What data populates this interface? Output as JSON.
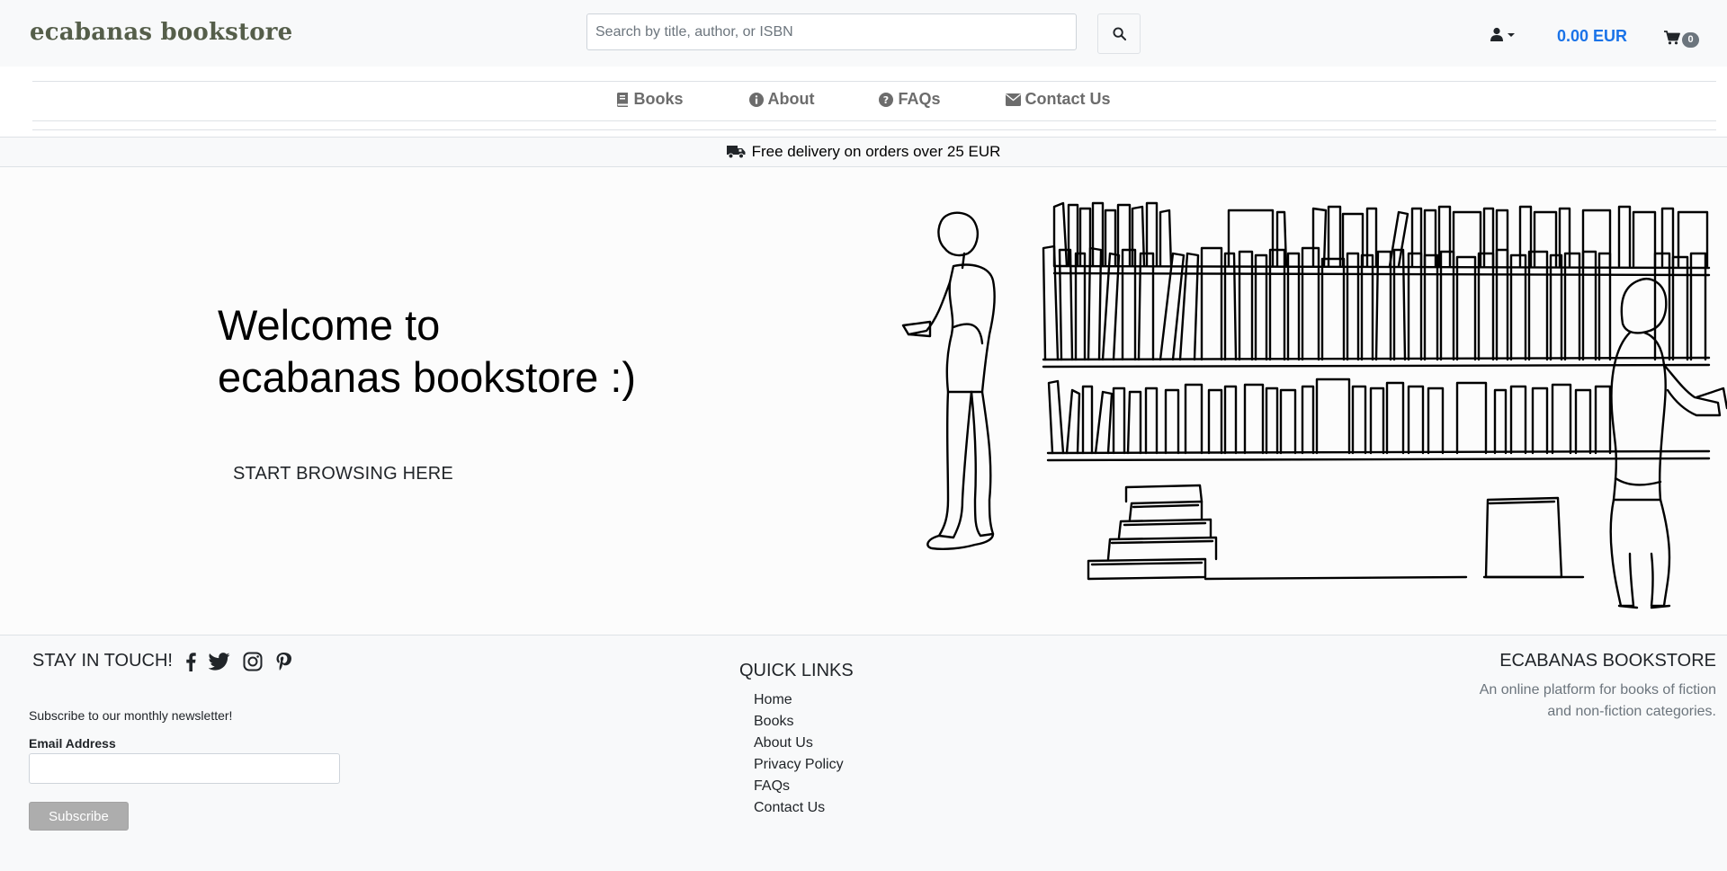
{
  "header": {
    "logo": "ecabanas bookstore",
    "search_placeholder": "Search by title, author, or ISBN",
    "balance": "0.00 EUR",
    "cart_count": "0"
  },
  "nav": {
    "items": [
      {
        "label": "Books",
        "icon": "book-icon"
      },
      {
        "label": "About",
        "icon": "info-icon"
      },
      {
        "label": "FAQs",
        "icon": "question-icon"
      },
      {
        "label": "Contact Us",
        "icon": "envelope-icon"
      }
    ]
  },
  "promo": {
    "text": "Free delivery on orders over 25 EUR"
  },
  "hero": {
    "title_line1": "Welcome to",
    "title_line2": "ecabanas bookstore :)",
    "cta": "START BROWSING HERE"
  },
  "footer": {
    "stay_in_touch": "STAY IN TOUCH!",
    "social": [
      "facebook-icon",
      "twitter-icon",
      "instagram-icon",
      "pinterest-icon"
    ],
    "newsletter_note": "Subscribe to our monthly newsletter!",
    "email_label": "Email Address",
    "email_value": "",
    "subscribe_label": "Subscribe",
    "quick_links_title": "QUICK LINKS",
    "quick_links": [
      "Home",
      "Books",
      "About Us",
      "Privacy Policy",
      "FAQs",
      "Contact Us"
    ],
    "brand_title": "ECABANAS BOOKSTORE",
    "brand_desc": "An online platform for books of fiction and non-fiction categories."
  },
  "colors": {
    "accent_blue": "#1a73e8",
    "logo": "#555e4a",
    "nav_text": "#6c6c6c",
    "subscribe_bg": "#adadad"
  }
}
